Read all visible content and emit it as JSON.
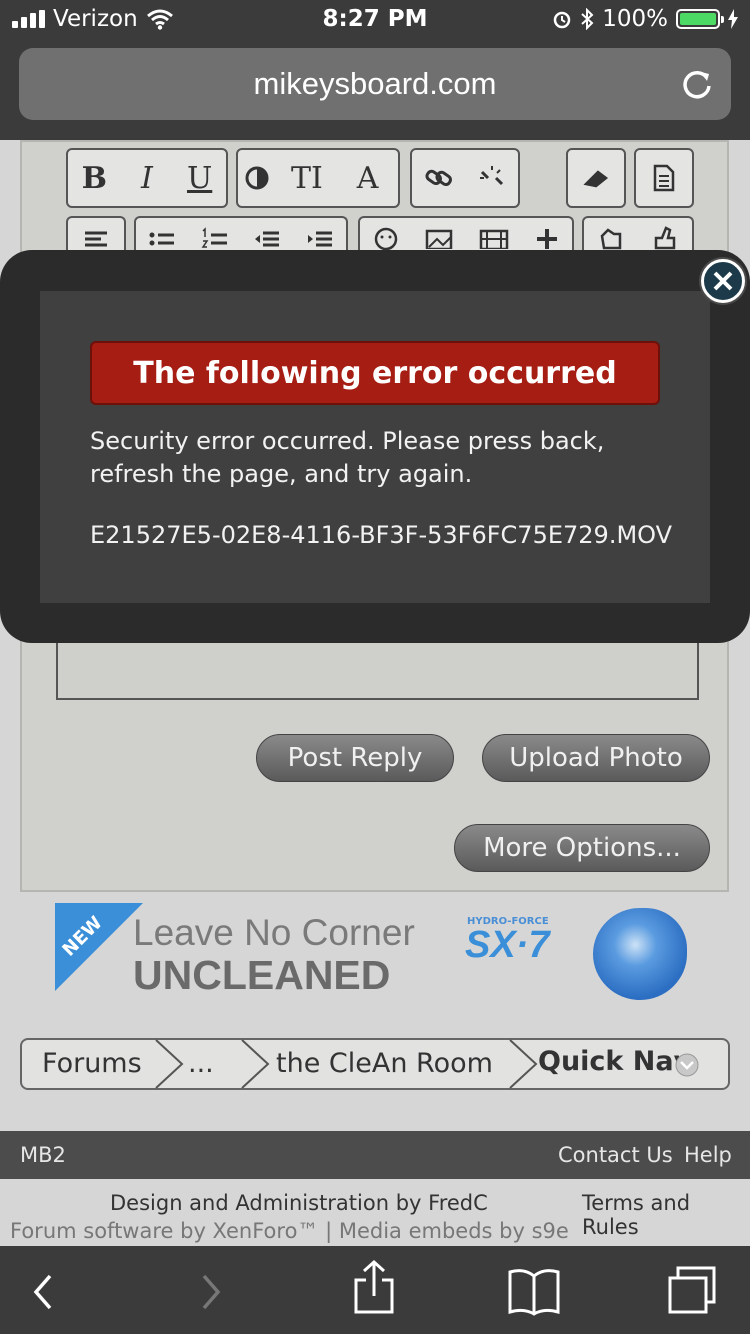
{
  "status_bar": {
    "carrier": "Verizon",
    "time": "8:27 PM",
    "battery": "100%"
  },
  "browser": {
    "url": "mikeysboard.com"
  },
  "toolbar": {
    "bold": "B",
    "italic": "I",
    "underline": "U",
    "text_size": "TI",
    "font": "A"
  },
  "error_dialog": {
    "title": "The following error occurred",
    "message": "Security error occurred. Please press back, refresh the page, and try again.",
    "filename": "E21527E5-02E8-4116-BF3F-53F6FC75E729.MOV"
  },
  "actions": {
    "post_reply": "Post Reply",
    "upload_photo": "Upload Photo",
    "more_options": "More Options..."
  },
  "ad": {
    "badge": "NEW",
    "line1": "Leave No Corner",
    "line2": "UNCLEANED",
    "brand_top": "HYDRO-FORCE",
    "brand": "SX·7"
  },
  "breadcrumb": {
    "items": [
      "Forums",
      "...",
      "the CleAn Room"
    ],
    "quick_nav": "Quick Nav"
  },
  "footer": {
    "site": "MB2",
    "contact": "Contact Us",
    "help": "Help",
    "credit": "Design and Administration by FredC",
    "terms": "Terms and Rules",
    "software": "Forum software by XenForo™ | Media embeds by s9e"
  },
  "colors": {
    "error_header": "#a61d13",
    "accent_battery": "#4cd964",
    "ad_blue": "#3a8fd8"
  }
}
